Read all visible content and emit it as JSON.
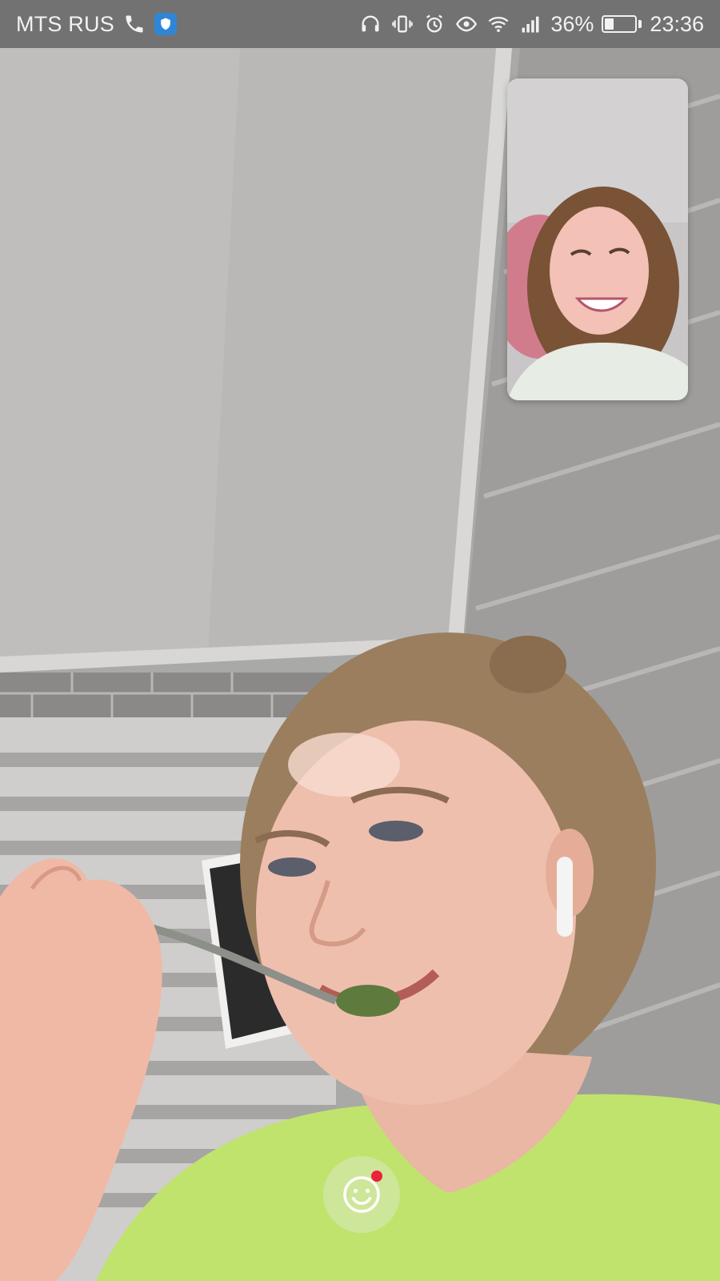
{
  "status_bar": {
    "carrier": "MTS RUS",
    "battery_text": "36%",
    "battery_level": 0.36,
    "time": "23:36",
    "icons_left": [
      "phone-icon",
      "shield-icon"
    ],
    "icons_right": [
      "headphones-icon",
      "vibrate-icon",
      "alarm-icon",
      "eye-icon",
      "wifi-icon",
      "signal-icon",
      "battery-icon"
    ],
    "colors": {
      "text": "#f2f2f2",
      "shield": "#2f86d6"
    }
  },
  "call": {
    "main_video": "remote-video",
    "self_preview": "self-video",
    "effects_button": {
      "icon": "smiley-icon",
      "has_notification": true,
      "notification_color": "#e8233a"
    }
  }
}
